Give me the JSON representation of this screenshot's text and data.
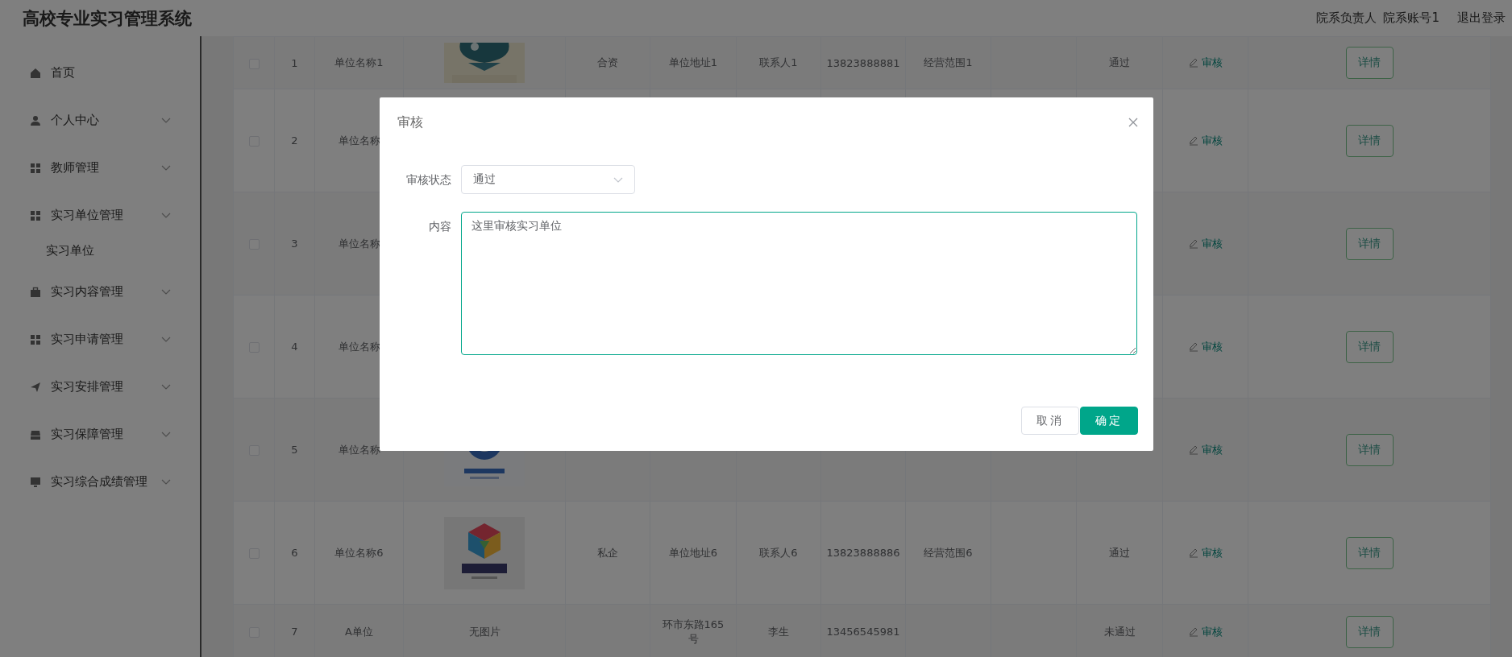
{
  "header": {
    "title": "高校专业实习管理系统",
    "role": "院系负责人",
    "account": "院系账号1",
    "logout": "退出登录"
  },
  "sidebar": {
    "items": [
      {
        "label": "首页",
        "expandable": false
      },
      {
        "label": "个人中心",
        "expandable": true
      },
      {
        "label": "教师管理",
        "expandable": true
      },
      {
        "label": "实习单位管理",
        "expandable": true,
        "children": [
          {
            "label": "实习单位"
          }
        ]
      },
      {
        "label": "实习内容管理",
        "expandable": true
      },
      {
        "label": "实习申请管理",
        "expandable": true
      },
      {
        "label": "实习安排管理",
        "expandable": true
      },
      {
        "label": "实习保障管理",
        "expandable": true
      },
      {
        "label": "实习综合成绩管理",
        "expandable": true
      }
    ]
  },
  "table": {
    "rows": [
      {
        "checked": false,
        "cells": [
          {
            "kind": "text",
            "text": "1"
          },
          {
            "kind": "text",
            "text": "单位名称1"
          },
          {
            "kind": "picture"
          },
          {
            "kind": "text",
            "text": "合资"
          },
          {
            "kind": "text",
            "text": "单位地址1"
          },
          {
            "kind": "text",
            "text": "联系人1"
          },
          {
            "kind": "text",
            "text": "13823888881"
          },
          {
            "kind": "text",
            "text": "经营范围1"
          },
          {
            "kind": "blank"
          },
          {
            "kind": "text",
            "text": "通过"
          }
        ],
        "action_link": "审核",
        "detail_button": "详情"
      },
      {
        "checked": false,
        "cells": [
          {
            "kind": "text",
            "text": "2"
          },
          {
            "kind": "text",
            "text": "单位名称"
          }
        ],
        "action_link": "审核",
        "detail_button": "详情"
      },
      {
        "checked": false,
        "cells": [
          {
            "kind": "text",
            "text": "3"
          },
          {
            "kind": "text",
            "text": "单位名称"
          }
        ],
        "action_link": "审核",
        "detail_button": "详情"
      },
      {
        "checked": false,
        "cells": [
          {
            "kind": "text",
            "text": "4"
          },
          {
            "kind": "text",
            "text": "单位名称"
          }
        ],
        "action_link": "审核",
        "detail_button": "详情"
      },
      {
        "checked": false,
        "cells": [
          {
            "kind": "text",
            "text": "5"
          },
          {
            "kind": "text",
            "text": "单位名称"
          },
          {
            "kind": "picture"
          }
        ],
        "action_link": "审核",
        "detail_button": "详情"
      },
      {
        "checked": false,
        "cells": [
          {
            "kind": "text",
            "text": "6"
          },
          {
            "kind": "text",
            "text": "单位名称6"
          },
          {
            "kind": "picture"
          },
          {
            "kind": "text",
            "text": "私企"
          },
          {
            "kind": "text",
            "text": "单位地址6"
          },
          {
            "kind": "text",
            "text": "联系人6"
          },
          {
            "kind": "text",
            "text": "13823888886"
          },
          {
            "kind": "text",
            "text": "经营范围6"
          },
          {
            "kind": "blank"
          },
          {
            "kind": "text",
            "text": "通过"
          }
        ],
        "action_link": "审核",
        "detail_button": "详情"
      },
      {
        "checked": false,
        "cells": [
          {
            "kind": "text",
            "text": "7"
          },
          {
            "kind": "text",
            "text": "A单位"
          },
          {
            "kind": "text",
            "text": "无图片"
          },
          {
            "kind": "blank"
          },
          {
            "kind": "text",
            "text": "环市东路165号"
          },
          {
            "kind": "text",
            "text": "李生"
          },
          {
            "kind": "text",
            "text": "13456545981"
          },
          {
            "kind": "blank"
          },
          {
            "kind": "blank"
          },
          {
            "kind": "text",
            "text": "未通过"
          }
        ],
        "action_link": "审核",
        "detail_button": "详情"
      }
    ]
  },
  "dialog": {
    "title": "审核",
    "fields": [
      {
        "label": "审核状态",
        "kind": "select",
        "value": "通过",
        "focused": false
      },
      {
        "label": "内容",
        "kind": "textarea",
        "value": "这里审核实习单位",
        "focused": true
      }
    ],
    "buttons": [
      {
        "label": "取消",
        "kind": "secondary"
      },
      {
        "label": "确定",
        "kind": "primary"
      }
    ]
  }
}
